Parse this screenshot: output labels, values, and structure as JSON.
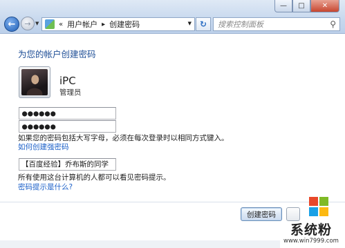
{
  "window": {
    "minimize_glyph": "—",
    "maximize_glyph": "□",
    "close_glyph": "✕"
  },
  "toolbar": {
    "back_glyph": "←",
    "forward_glyph": "→",
    "refresh_glyph": "↻"
  },
  "address": {
    "overflow": "«",
    "crumb1": "用户帐户",
    "separator": "▸",
    "crumb2": "创建密码"
  },
  "search": {
    "placeholder": "搜索控制面板",
    "icon": "search-icon"
  },
  "page": {
    "heading": "为您的帐户创建密码",
    "user_name": "iPC",
    "user_role": "管理员",
    "new_password_value": "●●●●●●",
    "confirm_password_value": "●●●●●●",
    "case_note": "如果您的密码包括大写字母，必须在每次登录时以相同方式键入。",
    "strong_password_link": "如何创建强密码",
    "hint_value": "【百度经验】乔布斯的同学",
    "visible_note": "所有使用这台计算机的人都可以看见密码提示。",
    "what_hint_link": "密码提示是什么?",
    "create_button": "创建密码"
  },
  "watermark": {
    "title": "系统粉",
    "url": "www.win7999.com",
    "colors": [
      "#e8482a",
      "#7fba26",
      "#1aa1e6",
      "#fcb912"
    ]
  }
}
